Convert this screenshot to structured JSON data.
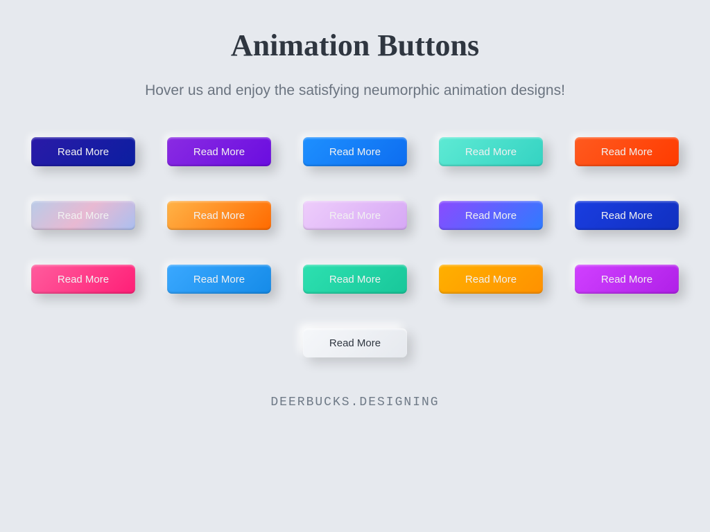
{
  "title": "Animation Buttons",
  "subtitle": "Hover us and enjoy the satisfying neumorphic animation designs!",
  "button_label": "Read More",
  "buttons": [
    {
      "name": "btn-navy",
      "cls": "c0",
      "text": "light"
    },
    {
      "name": "btn-violet",
      "cls": "c1",
      "text": "light"
    },
    {
      "name": "btn-azure",
      "cls": "c2",
      "text": "light"
    },
    {
      "name": "btn-teal",
      "cls": "c3",
      "text": "light"
    },
    {
      "name": "btn-red-orange",
      "cls": "c4",
      "text": "light"
    },
    {
      "name": "btn-pastel-grad",
      "cls": "c5",
      "text": "light"
    },
    {
      "name": "btn-orange",
      "cls": "c6",
      "text": "light"
    },
    {
      "name": "btn-lavender",
      "cls": "c7",
      "text": "light"
    },
    {
      "name": "btn-purple-blue",
      "cls": "c8",
      "text": "light"
    },
    {
      "name": "btn-royal-blue",
      "cls": "c9",
      "text": "light"
    },
    {
      "name": "btn-pink",
      "cls": "c10",
      "text": "light"
    },
    {
      "name": "btn-sky",
      "cls": "c11",
      "text": "light"
    },
    {
      "name": "btn-mint",
      "cls": "c12",
      "text": "light"
    },
    {
      "name": "btn-amber",
      "cls": "c13",
      "text": "light"
    },
    {
      "name": "btn-magenta",
      "cls": "c14",
      "text": "light"
    },
    {
      "name": "btn-neutral",
      "cls": "c15",
      "text": "dark"
    }
  ],
  "footer": "DEERBUCKS.DESIGNING"
}
